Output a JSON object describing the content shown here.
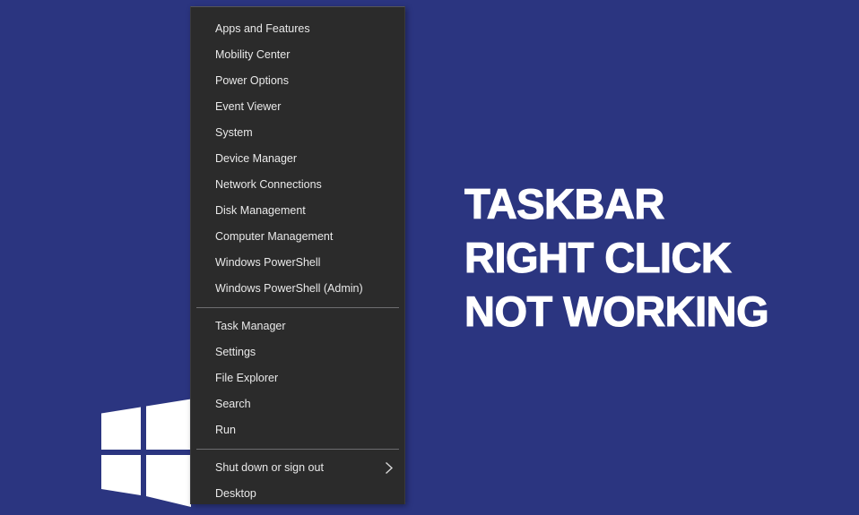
{
  "page": {
    "background_color": "#2b3580",
    "accent_color": "#ffffff"
  },
  "headline": {
    "lines": [
      "TASKBAR",
      "RIGHT CLICK",
      "NOT WORKING"
    ],
    "full_text": "TASKBAR RIGHT CLICK NOT WORKING",
    "color": "#ffffff"
  },
  "windows_logo": {
    "name": "windows-logo",
    "color": "#ffffff"
  },
  "context_menu": {
    "background_color": "#2b2b2b",
    "text_color": "#e9e9e9",
    "groups": [
      {
        "name": "system-tools-group",
        "items": [
          {
            "label": "Apps and Features",
            "submenu": false
          },
          {
            "label": "Mobility Center",
            "submenu": false
          },
          {
            "label": "Power Options",
            "submenu": false
          },
          {
            "label": "Event Viewer",
            "submenu": false
          },
          {
            "label": "System",
            "submenu": false
          },
          {
            "label": "Device Manager",
            "submenu": false
          },
          {
            "label": "Network Connections",
            "submenu": false
          },
          {
            "label": "Disk Management",
            "submenu": false
          },
          {
            "label": "Computer Management",
            "submenu": false
          },
          {
            "label": "Windows PowerShell",
            "submenu": false
          },
          {
            "label": "Windows PowerShell (Admin)",
            "submenu": false
          }
        ]
      },
      {
        "name": "shell-tools-group",
        "items": [
          {
            "label": "Task Manager",
            "submenu": false
          },
          {
            "label": "Settings",
            "submenu": false
          },
          {
            "label": "File Explorer",
            "submenu": false
          },
          {
            "label": "Search",
            "submenu": false
          },
          {
            "label": "Run",
            "submenu": false
          }
        ]
      },
      {
        "name": "session-group",
        "items": [
          {
            "label": "Shut down or sign out",
            "submenu": true,
            "submenu_icon": "chevron-right-icon"
          },
          {
            "label": "Desktop",
            "submenu": false
          }
        ]
      }
    ]
  }
}
